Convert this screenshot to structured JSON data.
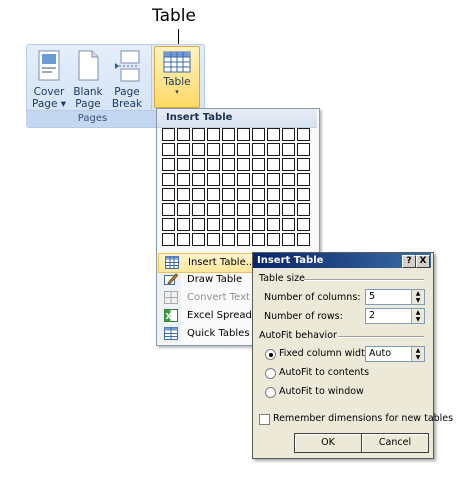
{
  "callout": {
    "label": "Table"
  },
  "ribbon": {
    "buttons": [
      {
        "line1": "Cover",
        "line2": "Page ▾"
      },
      {
        "line1": "Blank",
        "line2": "Page"
      },
      {
        "line1": "Page",
        "line2": "Break"
      }
    ],
    "group_label": "Pages",
    "table_button": {
      "label": "Table",
      "arrow": "▾"
    }
  },
  "dropdown": {
    "header": "Insert Table",
    "grid": {
      "columns": 10,
      "rows": 8
    },
    "items": [
      {
        "label": "Insert Table...",
        "icon": "insert-table-icon",
        "state": "highlighted"
      },
      {
        "label": "Draw Table",
        "icon": "draw-table-icon",
        "state": "normal"
      },
      {
        "label": "Convert Text to",
        "icon": "convert-text-icon",
        "state": "disabled"
      },
      {
        "label": "Excel Spreadshe",
        "icon": "excel-icon",
        "state": "normal"
      },
      {
        "label": "Quick Tables",
        "icon": "quick-tables-icon",
        "state": "normal"
      }
    ]
  },
  "dialog": {
    "title": "Insert Table",
    "help_button": "?",
    "close_button": "X",
    "table_size_label": "Table size",
    "columns_label": "Number of columns:",
    "columns_value": "5",
    "rows_label": "Number of rows:",
    "rows_value": "2",
    "autofit_label": "AutoFit behavior",
    "fixed_width_label": "Fixed column width:",
    "fixed_width_value": "Auto",
    "fit_contents_label": "AutoFit to contents",
    "fit_window_label": "AutoFit to window",
    "selected_autofit": "fixed",
    "remember_label": "Remember dimensions for new tables",
    "remember_checked": false,
    "ok_label": "OK",
    "cancel_label": "Cancel"
  }
}
